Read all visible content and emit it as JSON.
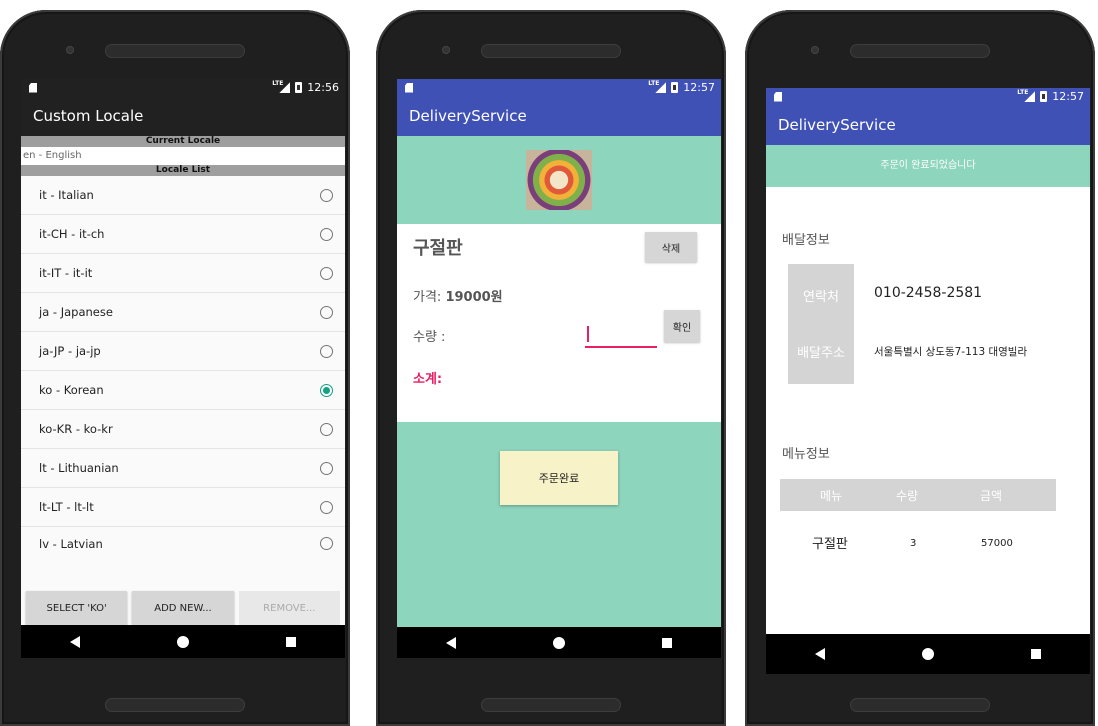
{
  "status": {
    "time1": "12:56",
    "time2": "12:57",
    "time3": "12:57",
    "network": "LTE"
  },
  "phone1": {
    "title": "Custom Locale",
    "current_header": "Current Locale",
    "current_value": "en - English",
    "list_header": "Locale List",
    "items": [
      {
        "label": "it - Italian",
        "checked": false
      },
      {
        "label": "it-CH - it-ch",
        "checked": false
      },
      {
        "label": "it-IT - it-it",
        "checked": false
      },
      {
        "label": "ja - Japanese",
        "checked": false
      },
      {
        "label": "ja-JP - ja-jp",
        "checked": false
      },
      {
        "label": "ko - Korean",
        "checked": true
      },
      {
        "label": "ko-KR - ko-kr",
        "checked": false
      },
      {
        "label": "lt - Lithuanian",
        "checked": false
      },
      {
        "label": "lt-LT - lt-lt",
        "checked": false
      },
      {
        "label": "lv - Latvian",
        "checked": false
      }
    ],
    "buttons": {
      "select": "SELECT 'KO'",
      "add": "ADD NEW...",
      "remove": "REMOVE..."
    }
  },
  "phone2": {
    "title": "DeliveryService",
    "dish": "구절판",
    "delete_btn": "삭제",
    "price_label": "가격:",
    "price_value": "19000원",
    "qty_label": "수량 :",
    "confirm_btn": "확인",
    "subtotal_label": "소계:",
    "order_btn": "주문완료"
  },
  "phone3": {
    "title": "DeliveryService",
    "banner": "주문이 완료되었습니다",
    "delivery_title": "배달정보",
    "contact_key": "연락처",
    "contact_val": "010-2458-2581",
    "address_key": "배달주소",
    "address_val": "서울특별시 상도동7-113 대영빌라",
    "menu_title": "메뉴정보",
    "table_headers": [
      "메뉴",
      "수량",
      "금액"
    ],
    "row": {
      "menu": "구절판",
      "qty": "3",
      "amount": "57000"
    }
  },
  "colors": {
    "teal": "#8dd5bd",
    "indigo": "#3f51b5",
    "pink": "#e91e63",
    "radio_checked": "#14a085"
  }
}
